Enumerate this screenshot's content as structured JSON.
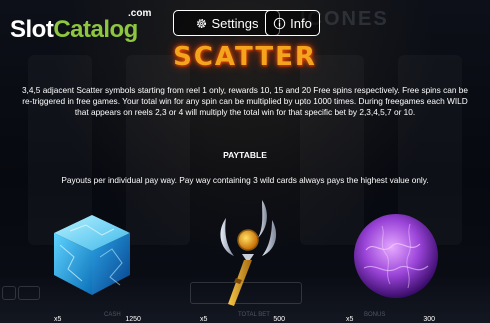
{
  "logo": {
    "part1": "Slot",
    "part2": "Catalog",
    "suffix": ".com"
  },
  "header": {
    "settings_label": "Settings",
    "info_label": "Info",
    "bg_game_title": "ICONES"
  },
  "colors": {
    "logo_green": "#8ec63f",
    "scatter_orange": "#f4a51d"
  },
  "info": {
    "title": "SCATTER",
    "description": "3,4,5 adjacent Scatter symbols starting from reel 1 only, rewards 10, 15 and 20 Free spins respectively. Free spins can be re-triggered in free games. Your total win for any spin can be multiplied by upto 1000 times. During freegames each WILD that appears on reels 2,3 or 4 will multiply the total win for that specific bet by 2,3,4,5,7 or 10.",
    "paytable_heading": "PAYTABLE",
    "payways_text": "Payouts per individual pay way. Pay way containing 3 wild cards always pays the highest value only."
  },
  "symbols": [
    {
      "name": "blue-crystal-cube",
      "multiplier": "x5",
      "payout": "1250"
    },
    {
      "name": "golden-scepter",
      "multiplier": "x5",
      "payout": "500"
    },
    {
      "name": "purple-orb",
      "multiplier": "x5",
      "payout": "300"
    }
  ],
  "bottom_labels": {
    "cash": "CASH",
    "total_bet": "TOTAL BET",
    "bonus": "BONUS"
  }
}
